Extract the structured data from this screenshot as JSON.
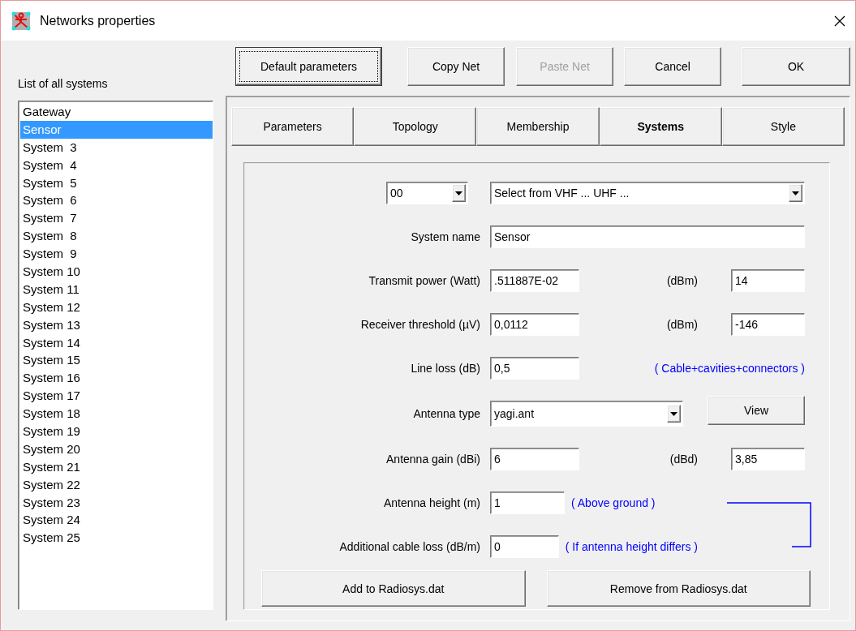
{
  "window": {
    "title": "Networks properties"
  },
  "systems_list": {
    "label": "List of all systems",
    "items": [
      {
        "label": "Gateway",
        "selected": false
      },
      {
        "label": "Sensor",
        "selected": true
      },
      {
        "label": "System  3",
        "selected": false
      },
      {
        "label": "System  4",
        "selected": false
      },
      {
        "label": "System  5",
        "selected": false
      },
      {
        "label": "System  6",
        "selected": false
      },
      {
        "label": "System  7",
        "selected": false
      },
      {
        "label": "System  8",
        "selected": false
      },
      {
        "label": "System  9",
        "selected": false
      },
      {
        "label": "System 10",
        "selected": false
      },
      {
        "label": "System 11",
        "selected": false
      },
      {
        "label": "System 12",
        "selected": false
      },
      {
        "label": "System 13",
        "selected": false
      },
      {
        "label": "System 14",
        "selected": false
      },
      {
        "label": "System 15",
        "selected": false
      },
      {
        "label": "System 16",
        "selected": false
      },
      {
        "label": "System 17",
        "selected": false
      },
      {
        "label": "System 18",
        "selected": false
      },
      {
        "label": "System 19",
        "selected": false
      },
      {
        "label": "System 20",
        "selected": false
      },
      {
        "label": "System 21",
        "selected": false
      },
      {
        "label": "System 22",
        "selected": false
      },
      {
        "label": "System 23",
        "selected": false
      },
      {
        "label": "System 24",
        "selected": false
      },
      {
        "label": "System 25",
        "selected": false
      }
    ]
  },
  "buttons": [
    {
      "label": "Default parameters",
      "focused": true,
      "disabled": false
    },
    {
      "label": "Copy Net",
      "focused": false,
      "disabled": false
    },
    {
      "label": "Paste Net",
      "focused": false,
      "disabled": true
    },
    {
      "label": "Cancel",
      "focused": false,
      "disabled": false
    },
    {
      "label": "OK",
      "focused": false,
      "disabled": false
    }
  ],
  "tabs": [
    {
      "label": "Parameters",
      "selected": false
    },
    {
      "label": "Topology",
      "selected": false
    },
    {
      "label": "Membership",
      "selected": false
    },
    {
      "label": "Systems",
      "selected": true
    },
    {
      "label": "Style",
      "selected": false
    }
  ],
  "form_rows": [
    {
      "kind": "selectors",
      "number": "00",
      "band": "Select from VHF ... UHF ..."
    },
    {
      "kind": "text",
      "label": "System name",
      "value": "Sensor"
    },
    {
      "kind": "pair",
      "label": "Transmit power (Watt)",
      "value": ".511887E-02",
      "unit_label": "(dBm)",
      "unit_value": "14"
    },
    {
      "kind": "pair",
      "label": "Receiver threshold (µV)",
      "value": "0,0112",
      "unit_label": "(dBm)",
      "unit_value": "-146"
    },
    {
      "kind": "note",
      "label": "Line loss (dB)",
      "value": "0,5",
      "note": "( Cable+cavities+connectors )"
    },
    {
      "kind": "combo_button",
      "label": "Antenna type",
      "value": "yagi.ant",
      "button": "View"
    },
    {
      "kind": "pair",
      "label": "Antenna gain (dBi)",
      "value": "6",
      "unit_label": "(dBd)",
      "unit_value": "3,85"
    },
    {
      "kind": "linked",
      "label": "Antenna height (m)",
      "value": "1",
      "note": "( Above ground )"
    },
    {
      "kind": "linked",
      "label": "Additional cable loss (dB/m)",
      "value": "0",
      "note": "( If antenna height differs )"
    }
  ],
  "actions": [
    "Add to Radiosys.dat",
    "Remove from Radiosys.dat"
  ]
}
